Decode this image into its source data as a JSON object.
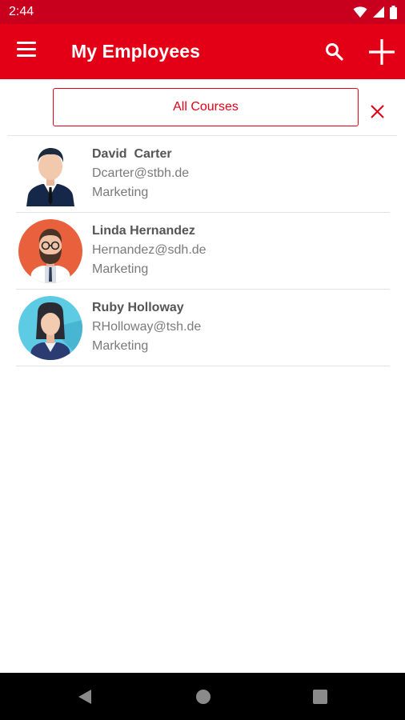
{
  "status_bar": {
    "time": "2:44",
    "icons": [
      "wifi-icon",
      "cellular-signal-icon",
      "battery-icon"
    ]
  },
  "app_bar": {
    "title": "My Employees",
    "icons": [
      "menu-icon",
      "search-icon",
      "add-icon"
    ],
    "color": "#e30016"
  },
  "filter": {
    "label": "All Courses",
    "clear_icon": "close-icon"
  },
  "employees": [
    {
      "name": "David  Carter",
      "email": "Dcarter@stbh.de",
      "department": "Marketing",
      "avatar": "man-suit-avatar"
    },
    {
      "name": "Linda Hernandez",
      "email": "Hernandez@sdh.de",
      "department": "Marketing",
      "avatar": "bearded-man-avatar"
    },
    {
      "name": "Ruby Holloway",
      "email": "RHolloway@tsh.de",
      "department": "Marketing",
      "avatar": "woman-avatar"
    }
  ],
  "nav_bar": {
    "icons": [
      "back-icon",
      "home-icon",
      "recents-icon"
    ]
  }
}
